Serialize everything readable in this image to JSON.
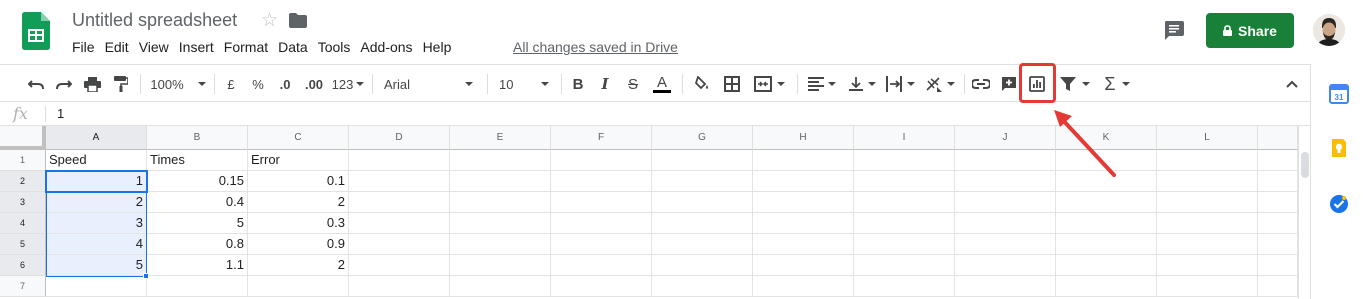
{
  "app": {
    "doc_title": "Untitled spreadsheet",
    "saved_status": "All changes saved in Drive",
    "share_label": "Share"
  },
  "menu": [
    "File",
    "Edit",
    "View",
    "Insert",
    "Format",
    "Data",
    "Tools",
    "Add-ons",
    "Help"
  ],
  "toolbar": {
    "zoom": "100%",
    "currency": "£",
    "percent": "%",
    "dec_decrease": ".0",
    "dec_increase": ".00",
    "more_formats": "123",
    "font": "Arial",
    "font_size": "10",
    "bold": "B",
    "italic": "I",
    "strike": "S",
    "text_color": "A",
    "highlighted_tool": "insert-chart-icon"
  },
  "formula_bar": {
    "fx": "fx",
    "value": "1"
  },
  "columns": [
    "A",
    "B",
    "C",
    "D",
    "E",
    "F",
    "G",
    "H",
    "I",
    "J",
    "K",
    "L"
  ],
  "rows": [
    "1",
    "2",
    "3",
    "4",
    "5",
    "6",
    "7"
  ],
  "cells": {
    "header": [
      "Speed",
      "Times",
      "Error"
    ],
    "data": [
      [
        "1",
        "0.15",
        "0.1"
      ],
      [
        "2",
        "0.4",
        "2"
      ],
      [
        "3",
        "5",
        "0.3"
      ],
      [
        "4",
        "0.8",
        "0.9"
      ],
      [
        "5",
        "1.1",
        "2"
      ]
    ]
  },
  "colors": {
    "share_green": "#188038",
    "selection_blue": "#1a73e8",
    "annotation_red": "#e53935"
  }
}
